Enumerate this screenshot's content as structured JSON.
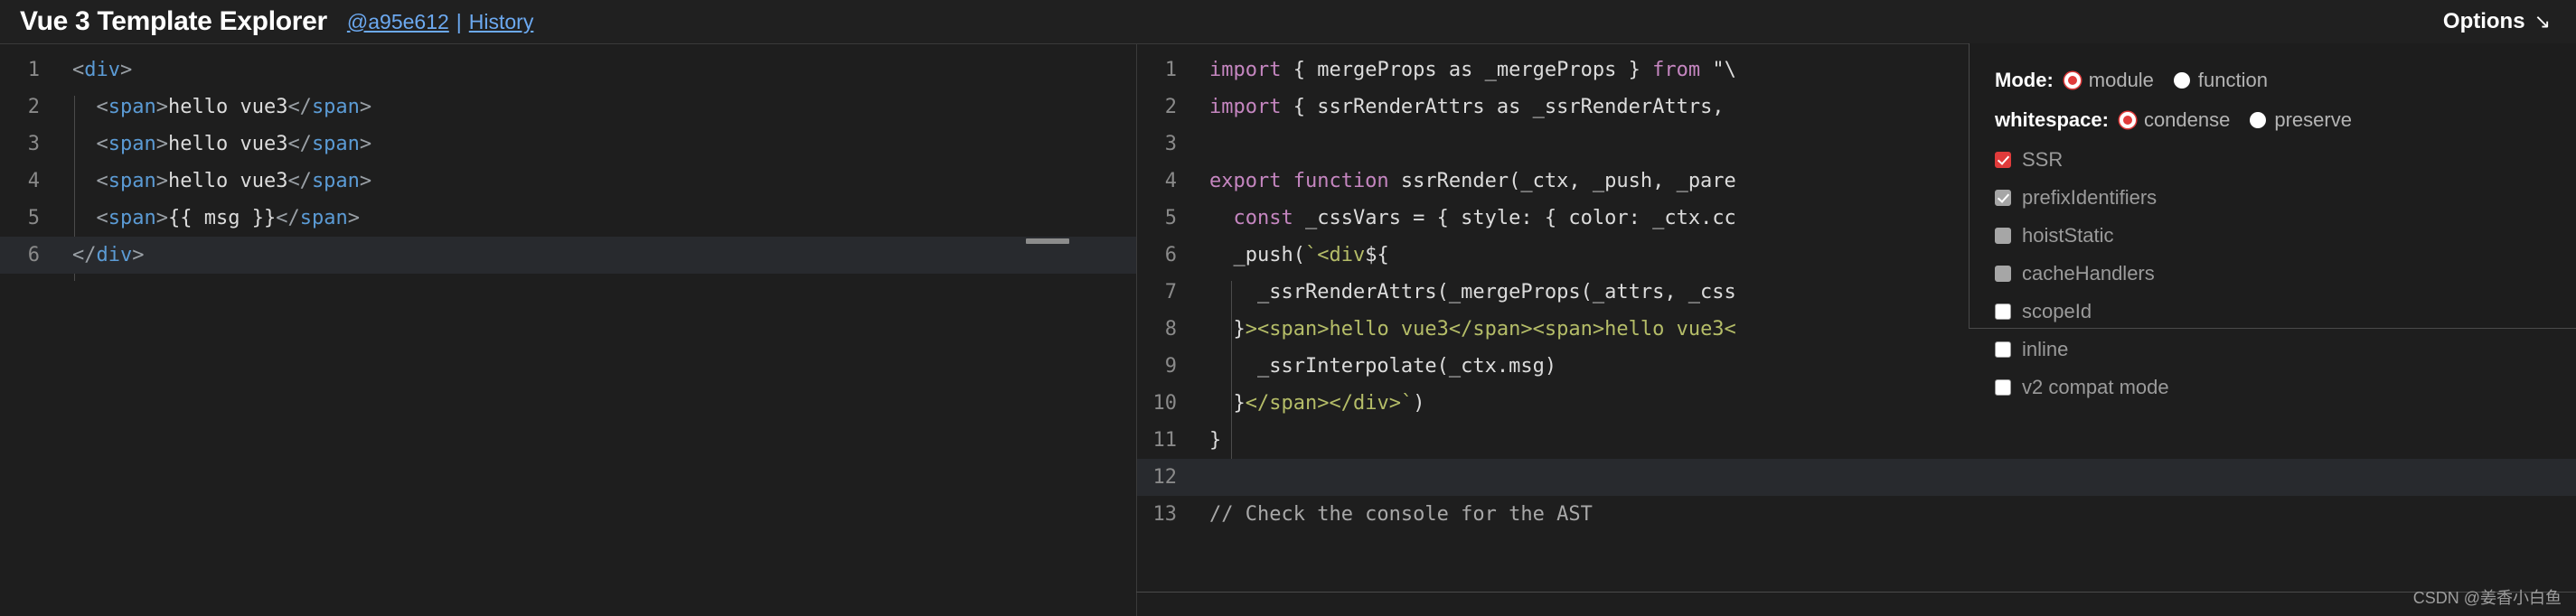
{
  "header": {
    "title": "Vue 3 Template Explorer",
    "commit_link": "@a95e612",
    "separator": "|",
    "history_link": "History",
    "options_label": "Options",
    "options_arrow": "↘"
  },
  "editor_left": {
    "name": "template-editor",
    "active_line": 6,
    "lines": [
      {
        "n": "1",
        "tokens": [
          {
            "t": "punct",
            "v": "<"
          },
          {
            "t": "tag",
            "v": "div"
          },
          {
            "t": "punct",
            "v": ">"
          }
        ]
      },
      {
        "n": "2",
        "tokens": [
          {
            "t": "plain",
            "v": "  "
          },
          {
            "t": "punct",
            "v": "<"
          },
          {
            "t": "tag",
            "v": "span"
          },
          {
            "t": "punct",
            "v": ">"
          },
          {
            "t": "text",
            "v": "hello vue3"
          },
          {
            "t": "punct",
            "v": "</"
          },
          {
            "t": "tag",
            "v": "span"
          },
          {
            "t": "punct",
            "v": ">"
          }
        ]
      },
      {
        "n": "3",
        "tokens": [
          {
            "t": "plain",
            "v": "  "
          },
          {
            "t": "punct",
            "v": "<"
          },
          {
            "t": "tag",
            "v": "span"
          },
          {
            "t": "punct",
            "v": ">"
          },
          {
            "t": "text",
            "v": "hello vue3"
          },
          {
            "t": "punct",
            "v": "</"
          },
          {
            "t": "tag",
            "v": "span"
          },
          {
            "t": "punct",
            "v": ">"
          }
        ]
      },
      {
        "n": "4",
        "tokens": [
          {
            "t": "plain",
            "v": "  "
          },
          {
            "t": "punct",
            "v": "<"
          },
          {
            "t": "tag",
            "v": "span"
          },
          {
            "t": "punct",
            "v": ">"
          },
          {
            "t": "text",
            "v": "hello vue3"
          },
          {
            "t": "punct",
            "v": "</"
          },
          {
            "t": "tag",
            "v": "span"
          },
          {
            "t": "punct",
            "v": ">"
          }
        ]
      },
      {
        "n": "5",
        "tokens": [
          {
            "t": "plain",
            "v": "  "
          },
          {
            "t": "punct",
            "v": "<"
          },
          {
            "t": "tag",
            "v": "span"
          },
          {
            "t": "punct",
            "v": ">"
          },
          {
            "t": "mustache",
            "v": "{{ msg }}"
          },
          {
            "t": "punct",
            "v": "</"
          },
          {
            "t": "tag",
            "v": "span"
          },
          {
            "t": "punct",
            "v": ">"
          }
        ]
      },
      {
        "n": "6",
        "tokens": [
          {
            "t": "punct",
            "v": "</"
          },
          {
            "t": "tag",
            "v": "div"
          },
          {
            "t": "punct",
            "v": ">"
          }
        ]
      }
    ]
  },
  "editor_right": {
    "name": "output-editor",
    "active_line": 12,
    "lines": [
      {
        "n": "1",
        "tokens": [
          {
            "t": "kw",
            "v": "import"
          },
          {
            "t": "plain",
            "v": " { mergeProps as _mergeProps } "
          },
          {
            "t": "kw",
            "v": "from"
          },
          {
            "t": "plain",
            "v": " \"\\"
          }
        ]
      },
      {
        "n": "2",
        "tokens": [
          {
            "t": "kw",
            "v": "import"
          },
          {
            "t": "plain",
            "v": " { ssrRenderAttrs as _ssrRenderAttrs,"
          }
        ]
      },
      {
        "n": "3",
        "tokens": []
      },
      {
        "n": "4",
        "tokens": [
          {
            "t": "kw",
            "v": "export function"
          },
          {
            "t": "plain",
            "v": " ssrRender(_ctx, _push, _pare"
          }
        ]
      },
      {
        "n": "5",
        "tokens": [
          {
            "t": "plain",
            "v": "  "
          },
          {
            "t": "kw",
            "v": "const"
          },
          {
            "t": "plain",
            "v": " _cssVars = { style: { color: _ctx.cc"
          }
        ]
      },
      {
        "n": "6",
        "tokens": [
          {
            "t": "plain",
            "v": "  _push("
          },
          {
            "t": "str",
            "v": "`"
          },
          {
            "t": "str",
            "v": "<div"
          },
          {
            "t": "plain",
            "v": "${"
          }
        ]
      },
      {
        "n": "7",
        "tokens": [
          {
            "t": "plain",
            "v": "    _ssrRenderAttrs(_mergeProps(_attrs, _css"
          }
        ]
      },
      {
        "n": "8",
        "tokens": [
          {
            "t": "plain",
            "v": "  }"
          },
          {
            "t": "str",
            "v": "><span>hello vue3</span><span>hello vue3<"
          }
        ]
      },
      {
        "n": "9",
        "tokens": [
          {
            "t": "plain",
            "v": "    _ssrInterpolate(_ctx.msg)"
          }
        ]
      },
      {
        "n": "10",
        "tokens": [
          {
            "t": "plain",
            "v": "  }"
          },
          {
            "t": "str",
            "v": "</span></div>`"
          },
          {
            "t": "plain",
            "v": ")"
          }
        ]
      },
      {
        "n": "11",
        "tokens": [
          {
            "t": "plain",
            "v": "}"
          }
        ]
      },
      {
        "n": "12",
        "tokens": []
      },
      {
        "n": "13",
        "tokens": [
          {
            "t": "comment",
            "v": "// Check the console for the AST"
          }
        ]
      }
    ]
  },
  "options": {
    "mode": {
      "label": "Mode:",
      "choices": [
        {
          "label": "module",
          "checked": true
        },
        {
          "label": "function",
          "checked": false
        }
      ]
    },
    "whitespace": {
      "label": "whitespace:",
      "choices": [
        {
          "label": "condense",
          "checked": true
        },
        {
          "label": "preserve",
          "checked": false
        }
      ]
    },
    "checkboxes": [
      {
        "label": "SSR",
        "checked": true,
        "disabled": false
      },
      {
        "label": "prefixIdentifiers",
        "checked": true,
        "disabled": true
      },
      {
        "label": "hoistStatic",
        "checked": false,
        "disabled": true
      },
      {
        "label": "cacheHandlers",
        "checked": false,
        "disabled": true
      },
      {
        "label": "scopeId",
        "checked": false,
        "disabled": false
      },
      {
        "label": "inline",
        "checked": false,
        "disabled": false
      },
      {
        "label": "v2 compat mode",
        "checked": false,
        "disabled": false
      }
    ]
  },
  "watermark": {
    "text": "CSDN @姜香小白鱼"
  },
  "colors": {
    "accent_red": "#e03b3b",
    "link_blue": "#6ca9f0",
    "tag_blue": "#5b9bd5",
    "keyword_purple": "#c586c0",
    "string_olive": "#b5bd68",
    "editor_bg": "#1e1e1e",
    "header_bg": "#202020"
  }
}
